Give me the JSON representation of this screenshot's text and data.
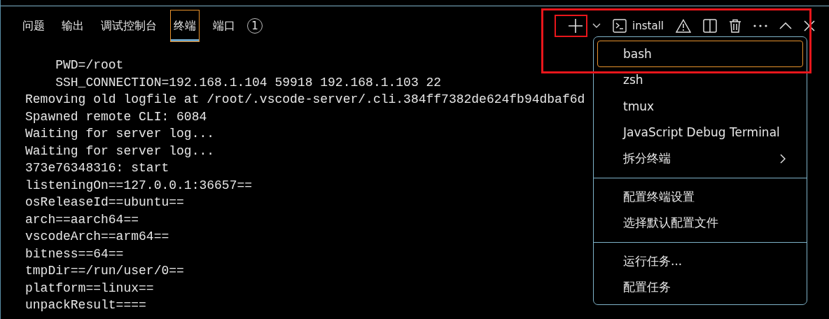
{
  "tabs": [
    {
      "label": "问题",
      "selected": false
    },
    {
      "label": "输出",
      "selected": false
    },
    {
      "label": "调试控制台",
      "selected": false
    },
    {
      "label": "终端",
      "selected": true
    },
    {
      "label": "端口",
      "selected": false,
      "badge": "1"
    }
  ],
  "toolbar": {
    "new_terminal_annotated": true,
    "terminal_name": "install"
  },
  "terminal_lines": [
    "    PWD=/root",
    "    SSH_CONNECTION=192.168.1.104 59918 192.168.1.103 22",
    "Removing old logfile at /root/.vscode-server/.cli.384ff7382de624fb94dbaf6d",
    "Spawned remote CLI: 6084",
    "Waiting for server log...",
    "Waiting for server log...",
    "373e76348316: start",
    "listeningOn==127.0.0.1:36657==",
    "osReleaseId==ubuntu==",
    "arch==aarch64==",
    "vscodeArch==arm64==",
    "bitness==64==",
    "tmpDir==/run/user/0==",
    "platform==linux==",
    "unpackResult===="
  ],
  "menu": {
    "groups": [
      [
        {
          "label": "bash",
          "selected": true,
          "submenu": false
        },
        {
          "label": "zsh",
          "selected": false,
          "submenu": false
        },
        {
          "label": "tmux",
          "selected": false,
          "submenu": false
        },
        {
          "label": "JavaScript Debug Terminal",
          "selected": false,
          "submenu": false
        },
        {
          "label": "拆分终端",
          "selected": false,
          "submenu": true
        }
      ],
      [
        {
          "label": "配置终端设置",
          "selected": false,
          "submenu": false
        },
        {
          "label": "选择默认配置文件",
          "selected": false,
          "submenu": false
        }
      ],
      [
        {
          "label": "运行任务...",
          "selected": false,
          "submenu": false
        },
        {
          "label": "配置任务",
          "selected": false,
          "submenu": false
        }
      ]
    ]
  }
}
